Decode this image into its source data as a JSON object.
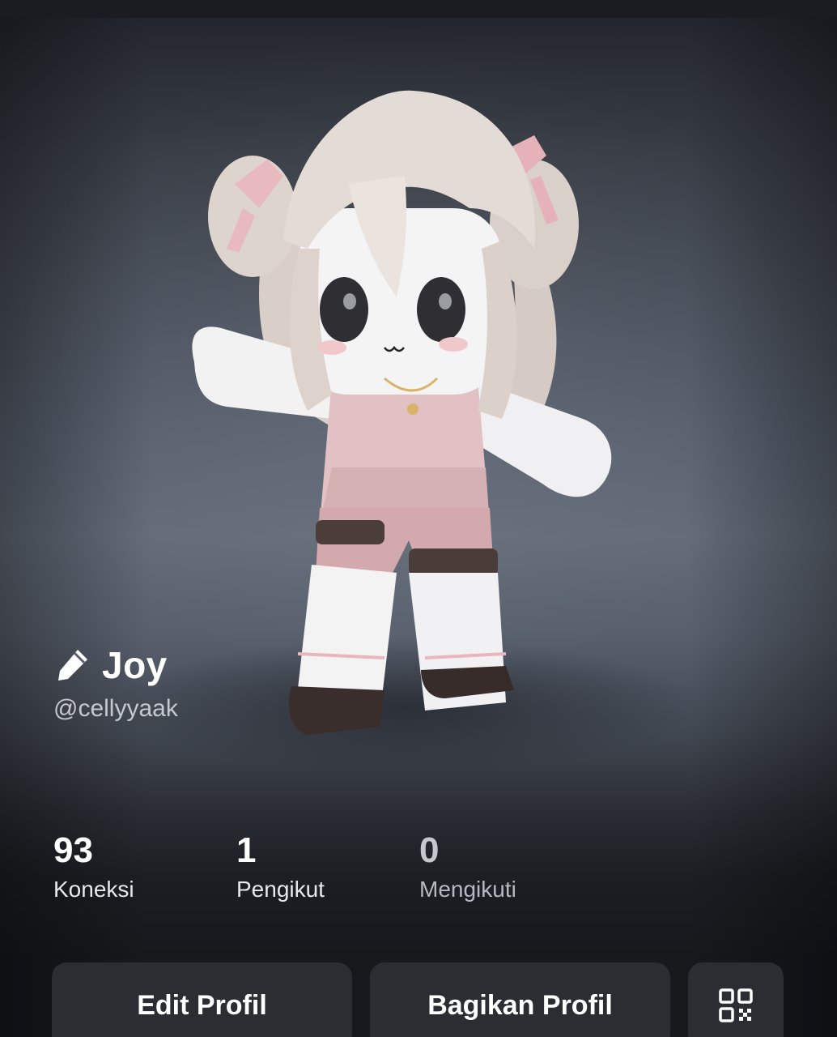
{
  "profile": {
    "display_name": "Joy",
    "username": "@cellyyaak",
    "edit_name_icon": "pencil-icon"
  },
  "stats": [
    {
      "value": "93",
      "label": "Koneksi"
    },
    {
      "value": "1",
      "label": "Pengikut"
    },
    {
      "value": "0",
      "label": "Mengikuti"
    }
  ],
  "actions": {
    "edit_label": "Edit Profil",
    "share_label": "Bagikan Profil",
    "qr_icon": "qr-code-icon"
  },
  "colors": {
    "background": "#17181c",
    "button": "#2b2d33",
    "text": "#ffffff",
    "muted_text": "#c6c9cf"
  }
}
